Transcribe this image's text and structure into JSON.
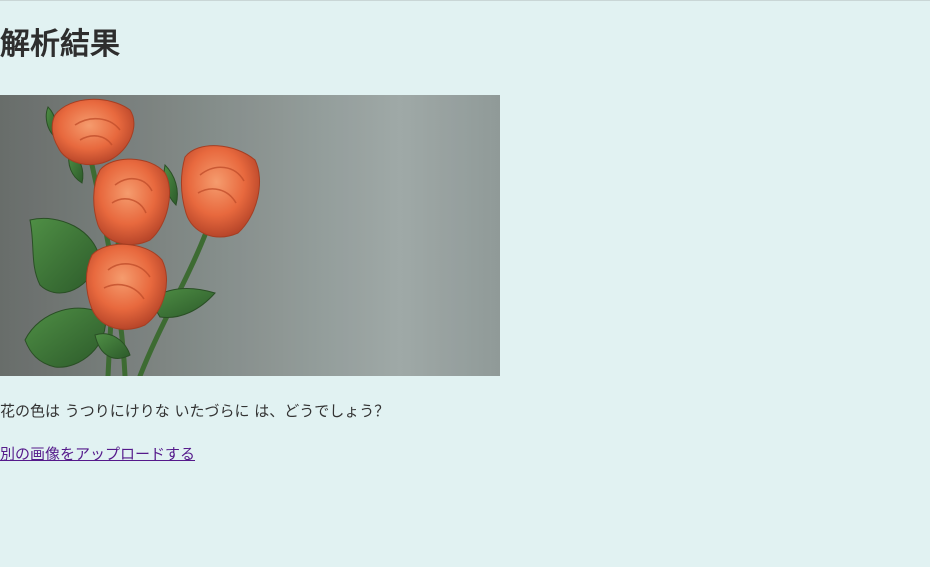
{
  "page": {
    "title": "解析結果",
    "image_alt": "rose-photo",
    "result_text": "花の色は うつりにけりな いたづらに は、どうでしょう？",
    "upload_link_label": "別の画像をアップロードする"
  },
  "colors": {
    "background": "#e1f2f2",
    "text": "#333333",
    "link_visited": "#551a8b",
    "rose": "#e8693e",
    "leaf": "#3f7a3a"
  }
}
